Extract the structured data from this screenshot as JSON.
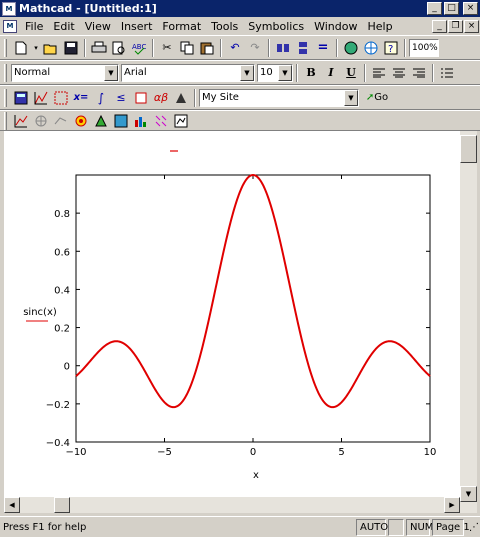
{
  "window": {
    "title": "Mathcad - [Untitled:1]",
    "app_icon": "mathcad-icon"
  },
  "menu": [
    "File",
    "Edit",
    "View",
    "Insert",
    "Format",
    "Tools",
    "Symbolics",
    "Window",
    "Help"
  ],
  "standard_toolbar": {
    "zoom": "100%"
  },
  "formatting_toolbar": {
    "style": "Normal",
    "font": "Arial",
    "size": "10",
    "bold": "B",
    "italic": "I",
    "underline": "U"
  },
  "math_toolbar": {
    "resource_combo": "My Site",
    "go_label": "Go"
  },
  "plot": {
    "y_label": "sinc(x)",
    "x_label": "x",
    "x_ticks": [
      "−10",
      "−5",
      "0",
      "5",
      "10"
    ],
    "y_ticks": [
      "0.8",
      "0.6",
      "0.4",
      "0.2",
      "0",
      "−0.2",
      "−0.4"
    ]
  },
  "chart_data": {
    "type": "line",
    "title": "",
    "xlabel": "x",
    "ylabel": "sinc(x)",
    "xlim": [
      -10,
      10
    ],
    "ylim": [
      -0.4,
      1
    ],
    "series": [
      {
        "name": "sinc(x)",
        "function": "sin(x)/x",
        "color": "#e00000",
        "x": [
          -10,
          -7.725,
          -4.493,
          0,
          4.493,
          7.725,
          10
        ],
        "y": [
          -0.054,
          0.128,
          -0.217,
          1.0,
          -0.217,
          0.128,
          -0.054
        ]
      }
    ]
  },
  "status": {
    "help": "Press F1 for help",
    "calc": "AUTO",
    "num": "NUM",
    "page": "Page 1"
  },
  "colors": {
    "trace": "#e00000",
    "titlebar": "#0a246a",
    "chrome": "#d4d0c8"
  }
}
